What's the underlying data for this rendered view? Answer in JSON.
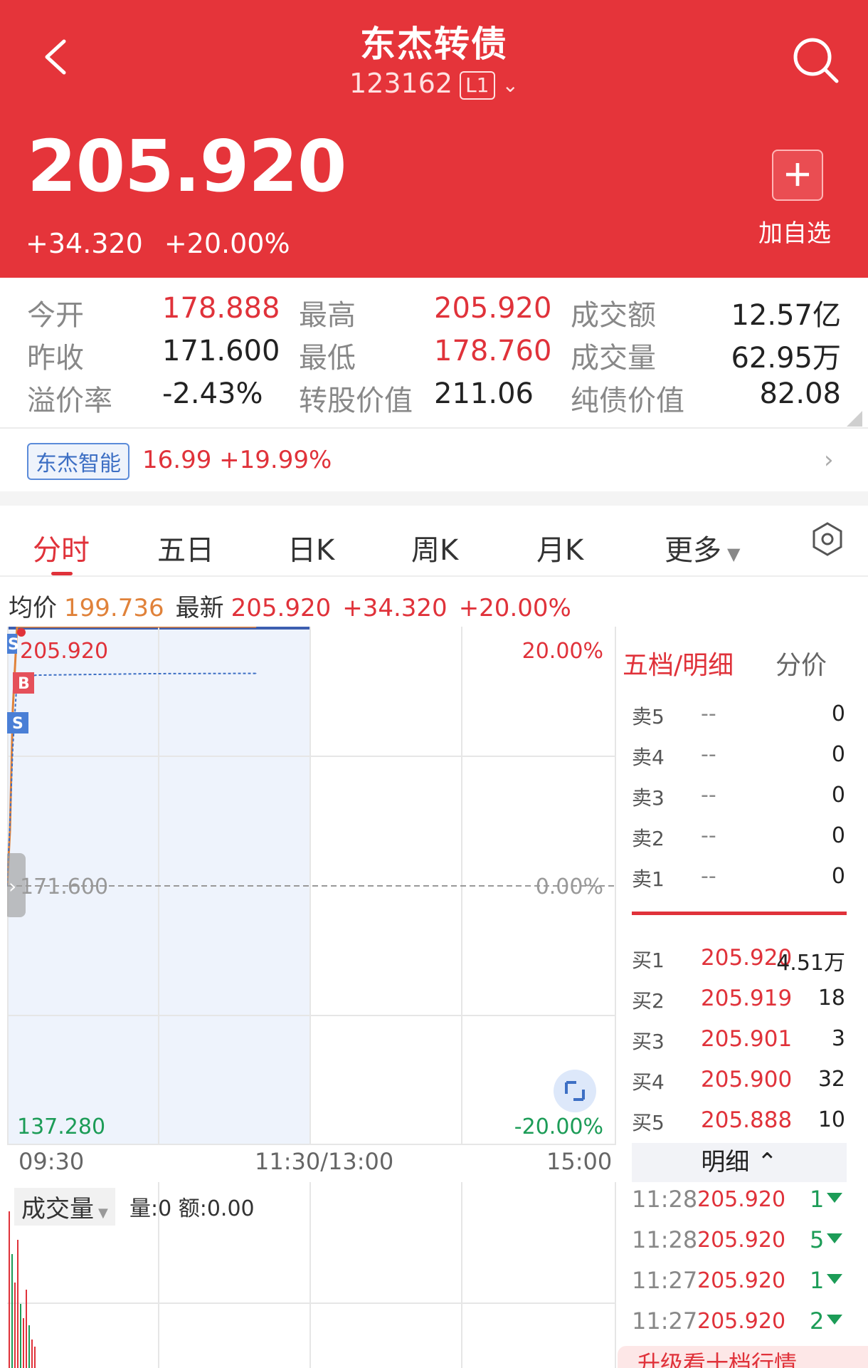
{
  "header": {
    "title": "东杰转债",
    "code": "123162",
    "level_badge": "L1",
    "price": "205.920",
    "change": "+34.320",
    "change_pct": "+20.00%",
    "add_watch_label": "加自选"
  },
  "stats": {
    "rows": [
      [
        {
          "label": "今开",
          "value": "178.888"
        },
        {
          "label": "最高",
          "value": "205.920"
        },
        {
          "label": "成交额",
          "value": "12.57亿"
        }
      ],
      [
        {
          "label": "昨收",
          "value": "171.600"
        },
        {
          "label": "最低",
          "value": "178.760"
        },
        {
          "label": "成交量",
          "value": "62.95万"
        }
      ],
      [
        {
          "label": "溢价率",
          "value": "-2.43%"
        },
        {
          "label": "转股价值",
          "value": "211.06"
        },
        {
          "label": "纯债价值",
          "value": "82.08"
        }
      ]
    ]
  },
  "underlying": {
    "tag": "东杰智能",
    "info": "16.99 +19.99%"
  },
  "tabs": [
    "分时",
    "五日",
    "日K",
    "周K",
    "月K",
    "更多"
  ],
  "avg_line": {
    "avg_label": "均价",
    "avg_value": "199.736",
    "latest_label": "最新",
    "latest_value": "205.920",
    "change": "+34.320",
    "change_pct": "+20.00%"
  },
  "chart": {
    "top_price": "205.920",
    "top_pct": "20.00%",
    "mid_price": "171.600",
    "mid_pct": "0.00%",
    "bottom_price": "137.280",
    "bottom_pct": "-20.00%",
    "x_start": "09:30",
    "x_mid": "11:30/13:00",
    "x_end": "15:00",
    "markers": [
      "S",
      "B",
      "S"
    ]
  },
  "chart_data": {
    "type": "line",
    "title": "",
    "series": [
      {
        "values": [
          171.6,
          178.888,
          195.0,
          205.92,
          205.92,
          205.92,
          205.92
        ]
      },
      {
        "values": [
          171.6,
          180.0,
          190.0,
          199.0,
          199.5,
          199.7,
          199.736
        ]
      }
    ],
    "ylim": [
      137.28,
      205.92
    ],
    "xlabel": "",
    "ylabel": ""
  },
  "order_book": {
    "title": "五档/明细",
    "tab2": "分价",
    "sells": [
      {
        "label": "卖5",
        "price": "--",
        "vol": "0"
      },
      {
        "label": "卖4",
        "price": "--",
        "vol": "0"
      },
      {
        "label": "卖3",
        "price": "--",
        "vol": "0"
      },
      {
        "label": "卖2",
        "price": "--",
        "vol": "0"
      },
      {
        "label": "卖1",
        "price": "--",
        "vol": "0"
      }
    ],
    "buys": [
      {
        "label": "买1",
        "price": "205.920",
        "vol": "4.51万"
      },
      {
        "label": "买2",
        "price": "205.919",
        "vol": "18"
      },
      {
        "label": "买3",
        "price": "205.901",
        "vol": "3"
      },
      {
        "label": "买4",
        "price": "205.900",
        "vol": "32"
      },
      {
        "label": "买5",
        "price": "205.888",
        "vol": "10"
      }
    ],
    "detail_label": "明细",
    "ticks": [
      {
        "time": "11:28",
        "price": "205.920",
        "vol": "1"
      },
      {
        "time": "11:28",
        "price": "205.920",
        "vol": "5"
      },
      {
        "time": "11:27",
        "price": "205.920",
        "vol": "1"
      },
      {
        "time": "11:27",
        "price": "205.920",
        "vol": "2"
      }
    ],
    "upgrade_label": "升级看十档行情"
  },
  "volume": {
    "label": "成交量",
    "info": "量:0 额:0.00"
  },
  "colors": {
    "brand_red": "#e5343a",
    "up": "#e0323a",
    "down": "#1c9c57",
    "avg_orange": "#e0823a"
  }
}
